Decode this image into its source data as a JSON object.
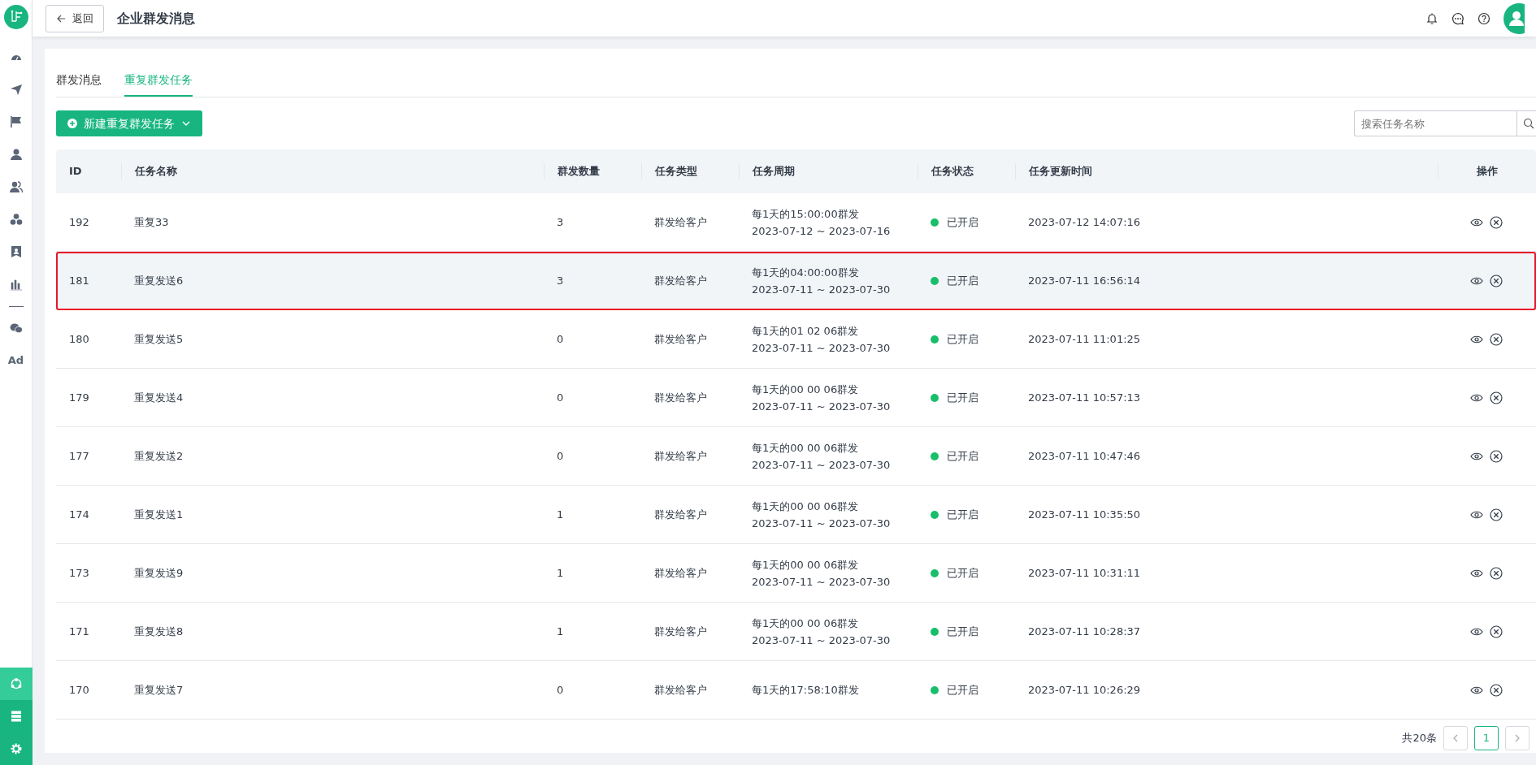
{
  "sidebar": {
    "ad_label": "Ad",
    "bottom_items": [
      {
        "selected": true
      },
      {
        "selected": false
      },
      {
        "selected": false
      }
    ]
  },
  "header": {
    "back_label": "返回",
    "title": "企业群发消息"
  },
  "tabs": [
    {
      "label": "群发消息",
      "selected": false
    },
    {
      "label": "重复群发任务",
      "selected": true
    }
  ],
  "new_button": {
    "label": "新建重复群发任务"
  },
  "search": {
    "placeholder": "搜索任务名称"
  },
  "table": {
    "columns": [
      "ID",
      "任务名称",
      "群发数量",
      "任务类型",
      "任务周期",
      "任务状态",
      "任务更新时间",
      "操作"
    ],
    "rows": [
      {
        "id": "192",
        "name": "重复33",
        "count": "3",
        "type": "群发给客户",
        "cycle": "每1天的15:00:00群发",
        "range": "2023-07-12 ~ 2023-07-16",
        "status": "已开启",
        "color": "#19be6b",
        "updated": "2023-07-12 14:07:16",
        "highlighted": false
      },
      {
        "id": "181",
        "name": "重复发送6",
        "count": "3",
        "type": "群发给客户",
        "cycle": "每1天的04:00:00群发",
        "range": "2023-07-11 ~ 2023-07-30",
        "status": "已开启",
        "color": "#19be6b",
        "updated": "2023-07-11 16:56:14",
        "highlighted": true
      },
      {
        "id": "180",
        "name": "重复发送5",
        "count": "0",
        "type": "群发给客户",
        "cycle": "每1天的01 02 06群发",
        "range": "2023-07-11 ~ 2023-07-30",
        "status": "已开启",
        "color": "#19be6b",
        "updated": "2023-07-11 11:01:25",
        "highlighted": false
      },
      {
        "id": "179",
        "name": "重复发送4",
        "count": "0",
        "type": "群发给客户",
        "cycle": "每1天的00 00 06群发",
        "range": "2023-07-11 ~ 2023-07-30",
        "status": "已开启",
        "color": "#19be6b",
        "updated": "2023-07-11 10:57:13",
        "highlighted": false
      },
      {
        "id": "177",
        "name": "重复发送2",
        "count": "0",
        "type": "群发给客户",
        "cycle": "每1天的00 00 06群发",
        "range": "2023-07-11 ~ 2023-07-30",
        "status": "已开启",
        "color": "#19be6b",
        "updated": "2023-07-11 10:47:46",
        "highlighted": false
      },
      {
        "id": "174",
        "name": "重复发送1",
        "count": "1",
        "type": "群发给客户",
        "cycle": "每1天的00 00 06群发",
        "range": "2023-07-11 ~ 2023-07-30",
        "status": "已开启",
        "color": "#19be6b",
        "updated": "2023-07-11 10:35:50",
        "highlighted": false
      },
      {
        "id": "173",
        "name": "重复发送9",
        "count": "1",
        "type": "群发给客户",
        "cycle": "每1天的00 00 06群发",
        "range": "2023-07-11 ~ 2023-07-30",
        "status": "已开启",
        "color": "#19be6b",
        "updated": "2023-07-11 10:31:11",
        "highlighted": false
      },
      {
        "id": "171",
        "name": "重复发送8",
        "count": "1",
        "type": "群发给客户",
        "cycle": "每1天的00 00 06群发",
        "range": "2023-07-11 ~ 2023-07-30",
        "status": "已开启",
        "color": "#19be6b",
        "updated": "2023-07-11 10:28:37",
        "highlighted": false
      },
      {
        "id": "170",
        "name": "重复发送7",
        "count": "0",
        "type": "群发给客户",
        "cycle": "每1天的17:58:10群发",
        "status": "已开启",
        "color": "#19be6b",
        "updated": "2023-07-11 10:26:29",
        "highlighted": false
      }
    ]
  },
  "pagination": {
    "total": "共20条",
    "pages": [
      {
        "label": "1",
        "selected": true
      }
    ]
  }
}
